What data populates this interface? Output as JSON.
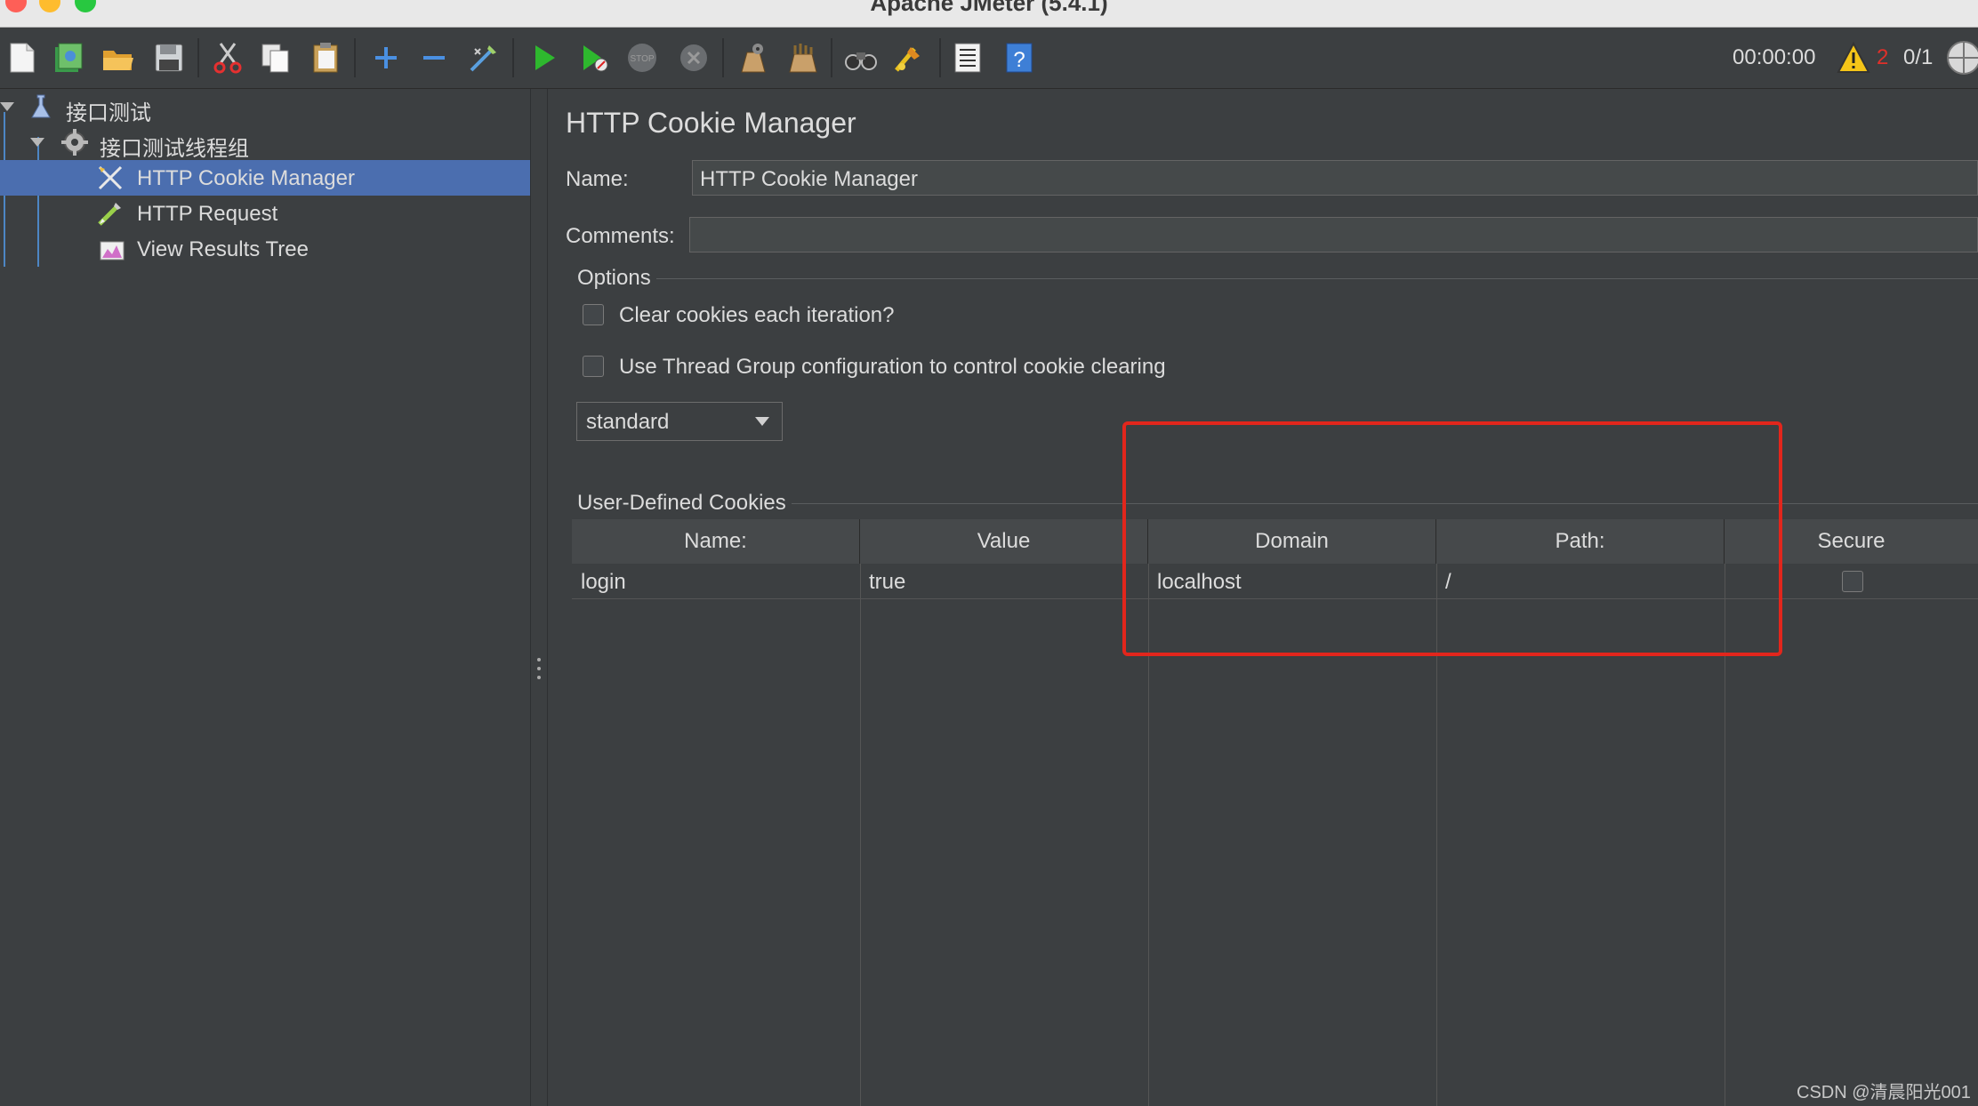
{
  "window": {
    "title": "Apache JMeter (5.4.1)"
  },
  "toolbar": {
    "icons": [
      "new-icon",
      "templates-icon",
      "open-icon",
      "save-icon",
      "cut-icon",
      "copy-icon",
      "paste-icon",
      "expand-icon",
      "collapse-icon",
      "toggle-icon",
      "start-icon",
      "start-no-pause-icon",
      "stop-icon",
      "shutdown-icon",
      "clear-icon",
      "clear-all-icon",
      "search-icon",
      "reset-search-icon",
      "function-helper-icon",
      "help-icon"
    ],
    "timer": "00:00:00",
    "error_count": "2",
    "threads": "0/1"
  },
  "tree": {
    "items": [
      {
        "label": "接口测试",
        "icon": "test-plan-icon"
      },
      {
        "label": "接口测试线程组",
        "icon": "thread-group-icon"
      },
      {
        "label": "HTTP Cookie Manager",
        "icon": "cookie-manager-icon",
        "selected": true
      },
      {
        "label": "HTTP Request",
        "icon": "http-request-icon"
      },
      {
        "label": "View Results Tree",
        "icon": "results-tree-icon"
      }
    ]
  },
  "main": {
    "title": "HTTP Cookie Manager",
    "name_label": "Name:",
    "name_value": "HTTP Cookie Manager",
    "comments_label": "Comments:",
    "comments_value": "",
    "options_title": "Options",
    "options": [
      {
        "label": "Clear cookies each iteration?",
        "checked": false
      },
      {
        "label": "Use Thread Group configuration to control cookie clearing",
        "checked": false
      }
    ],
    "policy": "standard",
    "cookies_title": "User-Defined Cookies",
    "columns": [
      "Name:",
      "Value",
      "Domain",
      "Path:",
      "Secure"
    ],
    "rows": [
      {
        "name": "login",
        "value": "true",
        "domain": "localhost",
        "path": "/",
        "secure": false
      }
    ]
  },
  "watermark": "CSDN @清晨阳光001",
  "colors": {
    "selection": "#4b6eaf",
    "highlight": "#e2261c",
    "background": "#3c3f41"
  }
}
